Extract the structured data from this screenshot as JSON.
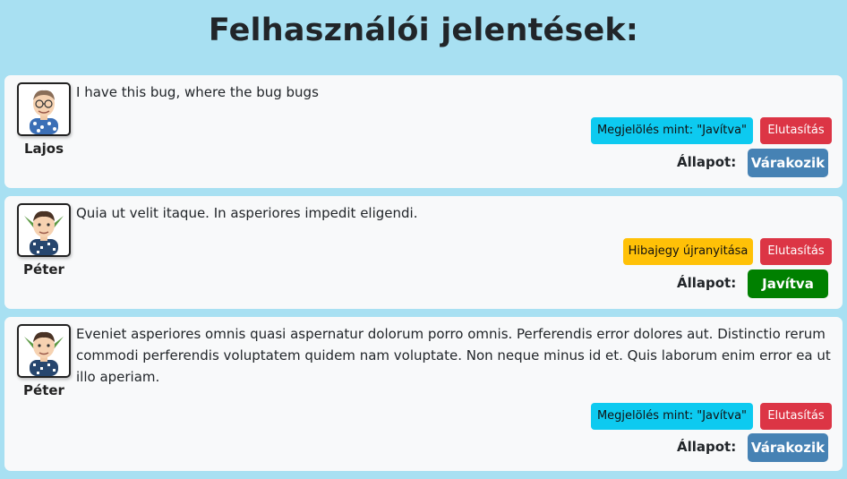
{
  "page": {
    "title": "Felhasználói jelentések:"
  },
  "colors": {
    "background": "#a8e0f2",
    "card": "#f8f9fa",
    "mark_button": "#0dcaf0",
    "reopen_button": "#ffc107",
    "reject_button": "#dc3545",
    "status_waiting": "#4682b4",
    "status_fixed": "#008000"
  },
  "reports": [
    {
      "user": "Lajos",
      "avatar_icon": "avatar-man-glasses-icon",
      "message": "I have this bug, where the bug bugs",
      "action_label": "Megjelölés mint: \"Javítva\"",
      "action_kind": "mark",
      "reject_label": "Elutasítás",
      "status_label": "Állapot:",
      "status": "Várakozik",
      "status_color": "#4682b4"
    },
    {
      "user": "Péter",
      "avatar_icon": "avatar-elf-icon",
      "message": "Quia ut velit itaque. In asperiores impedit eligendi.",
      "action_label": "Hibajegy újranyitása",
      "action_kind": "reopen",
      "reject_label": "Elutasítás",
      "status_label": "Állapot:",
      "status": "Javítva",
      "status_color": "#008000"
    },
    {
      "user": "Péter",
      "avatar_icon": "avatar-elf-icon",
      "message": "Eveniet asperiores omnis quasi aspernatur dolorum porro omnis. Perferendis error dolores aut. Distinctio rerum commodi perferendis voluptatem quidem nam voluptate. Non neque minus id et. Quis laborum enim error ea ut illo aperiam.",
      "action_label": "Megjelölés mint: \"Javítva\"",
      "action_kind": "mark",
      "reject_label": "Elutasítás",
      "status_label": "Állapot:",
      "status": "Várakozik",
      "status_color": "#4682b4"
    }
  ]
}
